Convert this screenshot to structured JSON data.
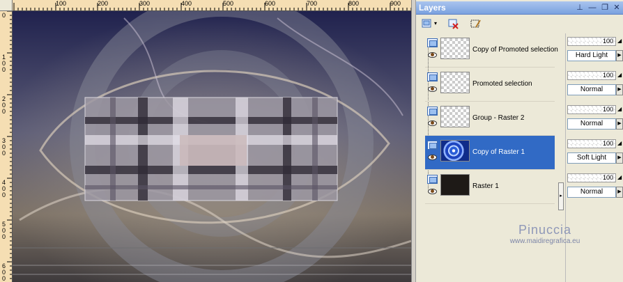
{
  "ruler": {
    "top_labels": [
      "100",
      "200",
      "300",
      "400",
      "500",
      "600",
      "700",
      "800",
      "900"
    ],
    "left_labels": [
      "0",
      "100",
      "200",
      "300",
      "400",
      "500",
      "600"
    ]
  },
  "palette": {
    "title": "Layers",
    "title_buttons": [
      "pin-icon",
      "minimize-icon",
      "maximize-icon",
      "close-icon"
    ]
  },
  "toolbar": {
    "tools": [
      "new-raster-layer-icon",
      "delete-layer-icon",
      "edit-selection-icon"
    ]
  },
  "layers": [
    {
      "name": "Copy of Promoted selection",
      "opacity": "100",
      "blend": "Hard Light",
      "thumb": "transparent",
      "selected": false
    },
    {
      "name": "Promoted selection",
      "opacity": "100",
      "blend": "Normal",
      "thumb": "transparent",
      "selected": false
    },
    {
      "name": "Group - Raster 2",
      "opacity": "100",
      "blend": "Normal",
      "thumb": "transparent",
      "selected": false
    },
    {
      "name": "Copy of Raster 1",
      "opacity": "100",
      "blend": "Soft Light",
      "thumb": "swirl",
      "selected": true
    },
    {
      "name": "Raster 1",
      "opacity": "100",
      "blend": "Normal",
      "thumb": "dark",
      "selected": false
    }
  ],
  "watermark": {
    "name": "Pinuccia",
    "url": "www.maidiregrafica.eu"
  },
  "colors": {
    "selection": "#316ac5",
    "titlebar": "#7aa1df",
    "canvas_dark": "#2a2c56",
    "canvas_mid": "#8e8070"
  }
}
